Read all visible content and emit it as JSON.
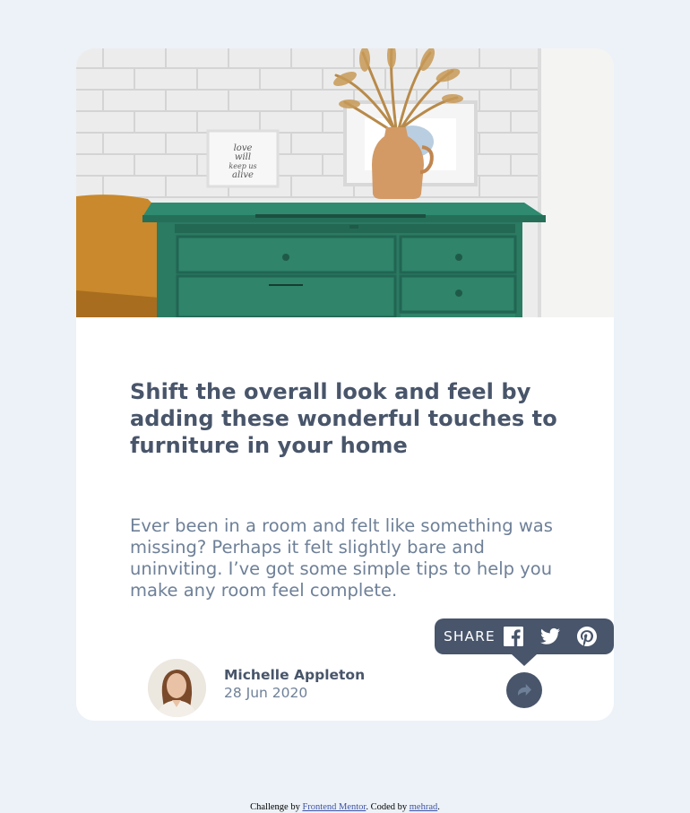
{
  "article": {
    "title": "Shift the overall look and feel by adding these wonderful touches to furniture in your home",
    "excerpt": "Ever been in a room and felt like something was missing? Perhaps it felt slightly bare and uninviting. I’ve got some simple tips to help you make any room feel complete.",
    "image_alt": "drawers"
  },
  "author": {
    "name": "Michelle Appleton",
    "date": "28 Jun 2020"
  },
  "share": {
    "label": "SHARE",
    "icons": [
      "facebook-icon",
      "twitter-icon",
      "pinterest-icon",
      "share-icon"
    ]
  },
  "attribution": {
    "prefix": "Challenge by",
    "link1": "Frontend Mentor",
    "middle": ". Coded by",
    "link2": "mehrad",
    "suffix": "."
  },
  "colors": {
    "background": "#ecf2f8",
    "card": "#ffffff",
    "dark_blue": "#48556a",
    "grayish_blue": "#6e8098",
    "dresser_green": "#2e7d6a"
  }
}
